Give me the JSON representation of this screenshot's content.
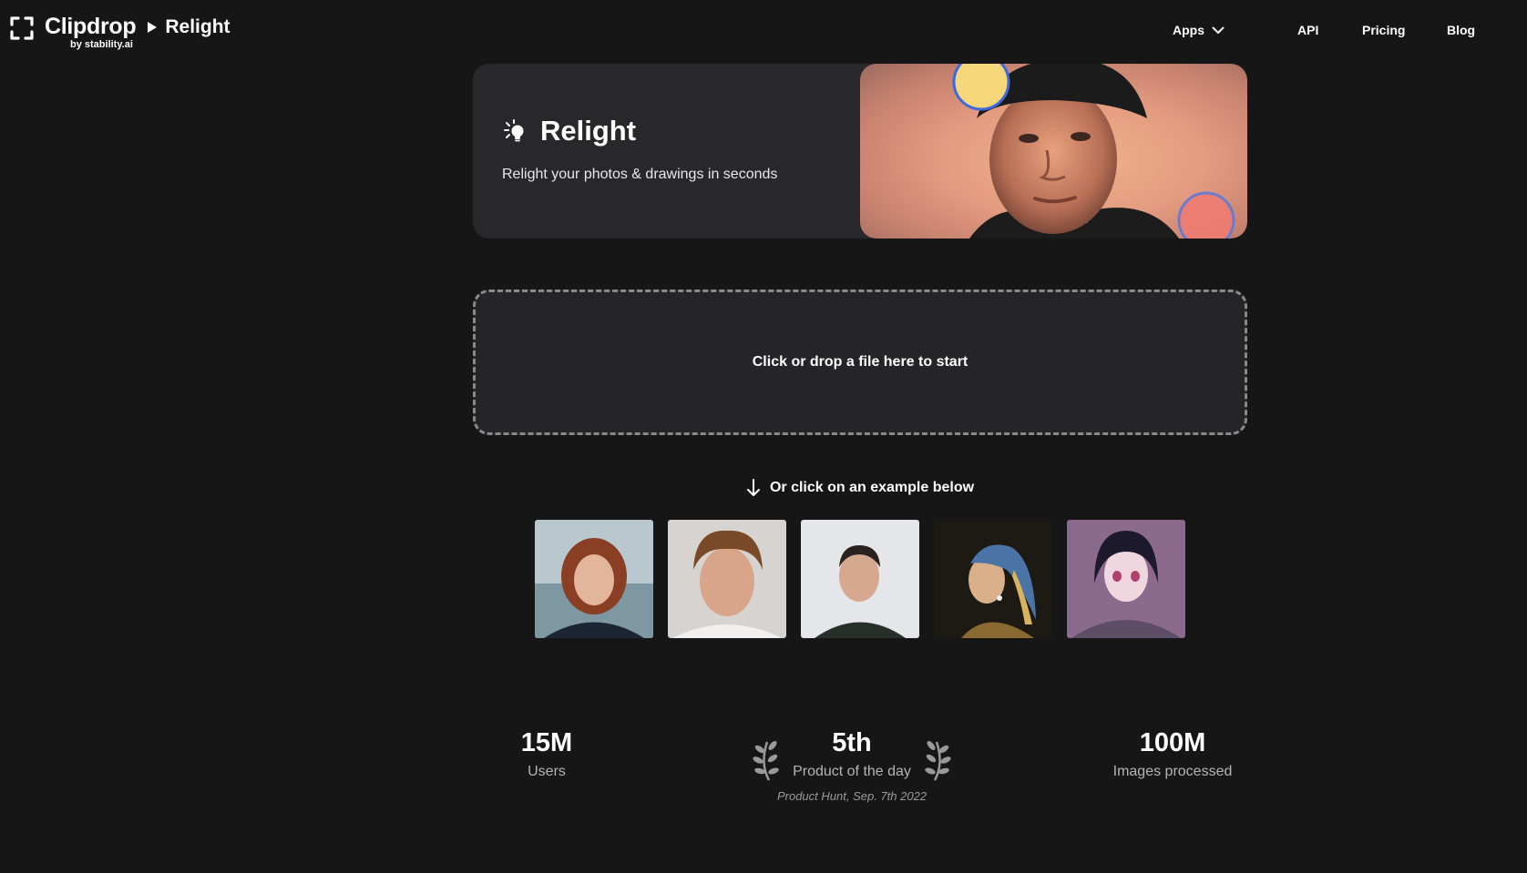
{
  "header": {
    "brand_name": "Clipdrop",
    "brand_by": "by stability.ai",
    "breadcrumb_page": "Relight",
    "nav": {
      "apps": "Apps",
      "api": "API",
      "pricing": "Pricing",
      "blog": "Blog"
    }
  },
  "hero": {
    "icon": "relight-bulb-icon",
    "title": "Relight",
    "subtitle": "Relight your photos & drawings in seconds"
  },
  "dropzone": {
    "label": "Click or drop a file here to start"
  },
  "examples": {
    "hint": "Or click on an example below",
    "items": [
      "example-woman-red-hair",
      "example-man-curly-hair",
      "example-man-dark-shirt",
      "example-girl-pearl-earring",
      "example-anime-girl"
    ]
  },
  "stats": {
    "users": {
      "value": "15M",
      "label": "Users"
    },
    "product_of_day": {
      "value": "5th",
      "label": "Product of the day",
      "note": "Product Hunt, Sep. 7th 2022"
    },
    "images": {
      "value": "100M",
      "label": "Images processed"
    }
  },
  "colors": {
    "background": "#161616",
    "card": "#28282b",
    "dropzone_border": "#8a8a8a"
  }
}
